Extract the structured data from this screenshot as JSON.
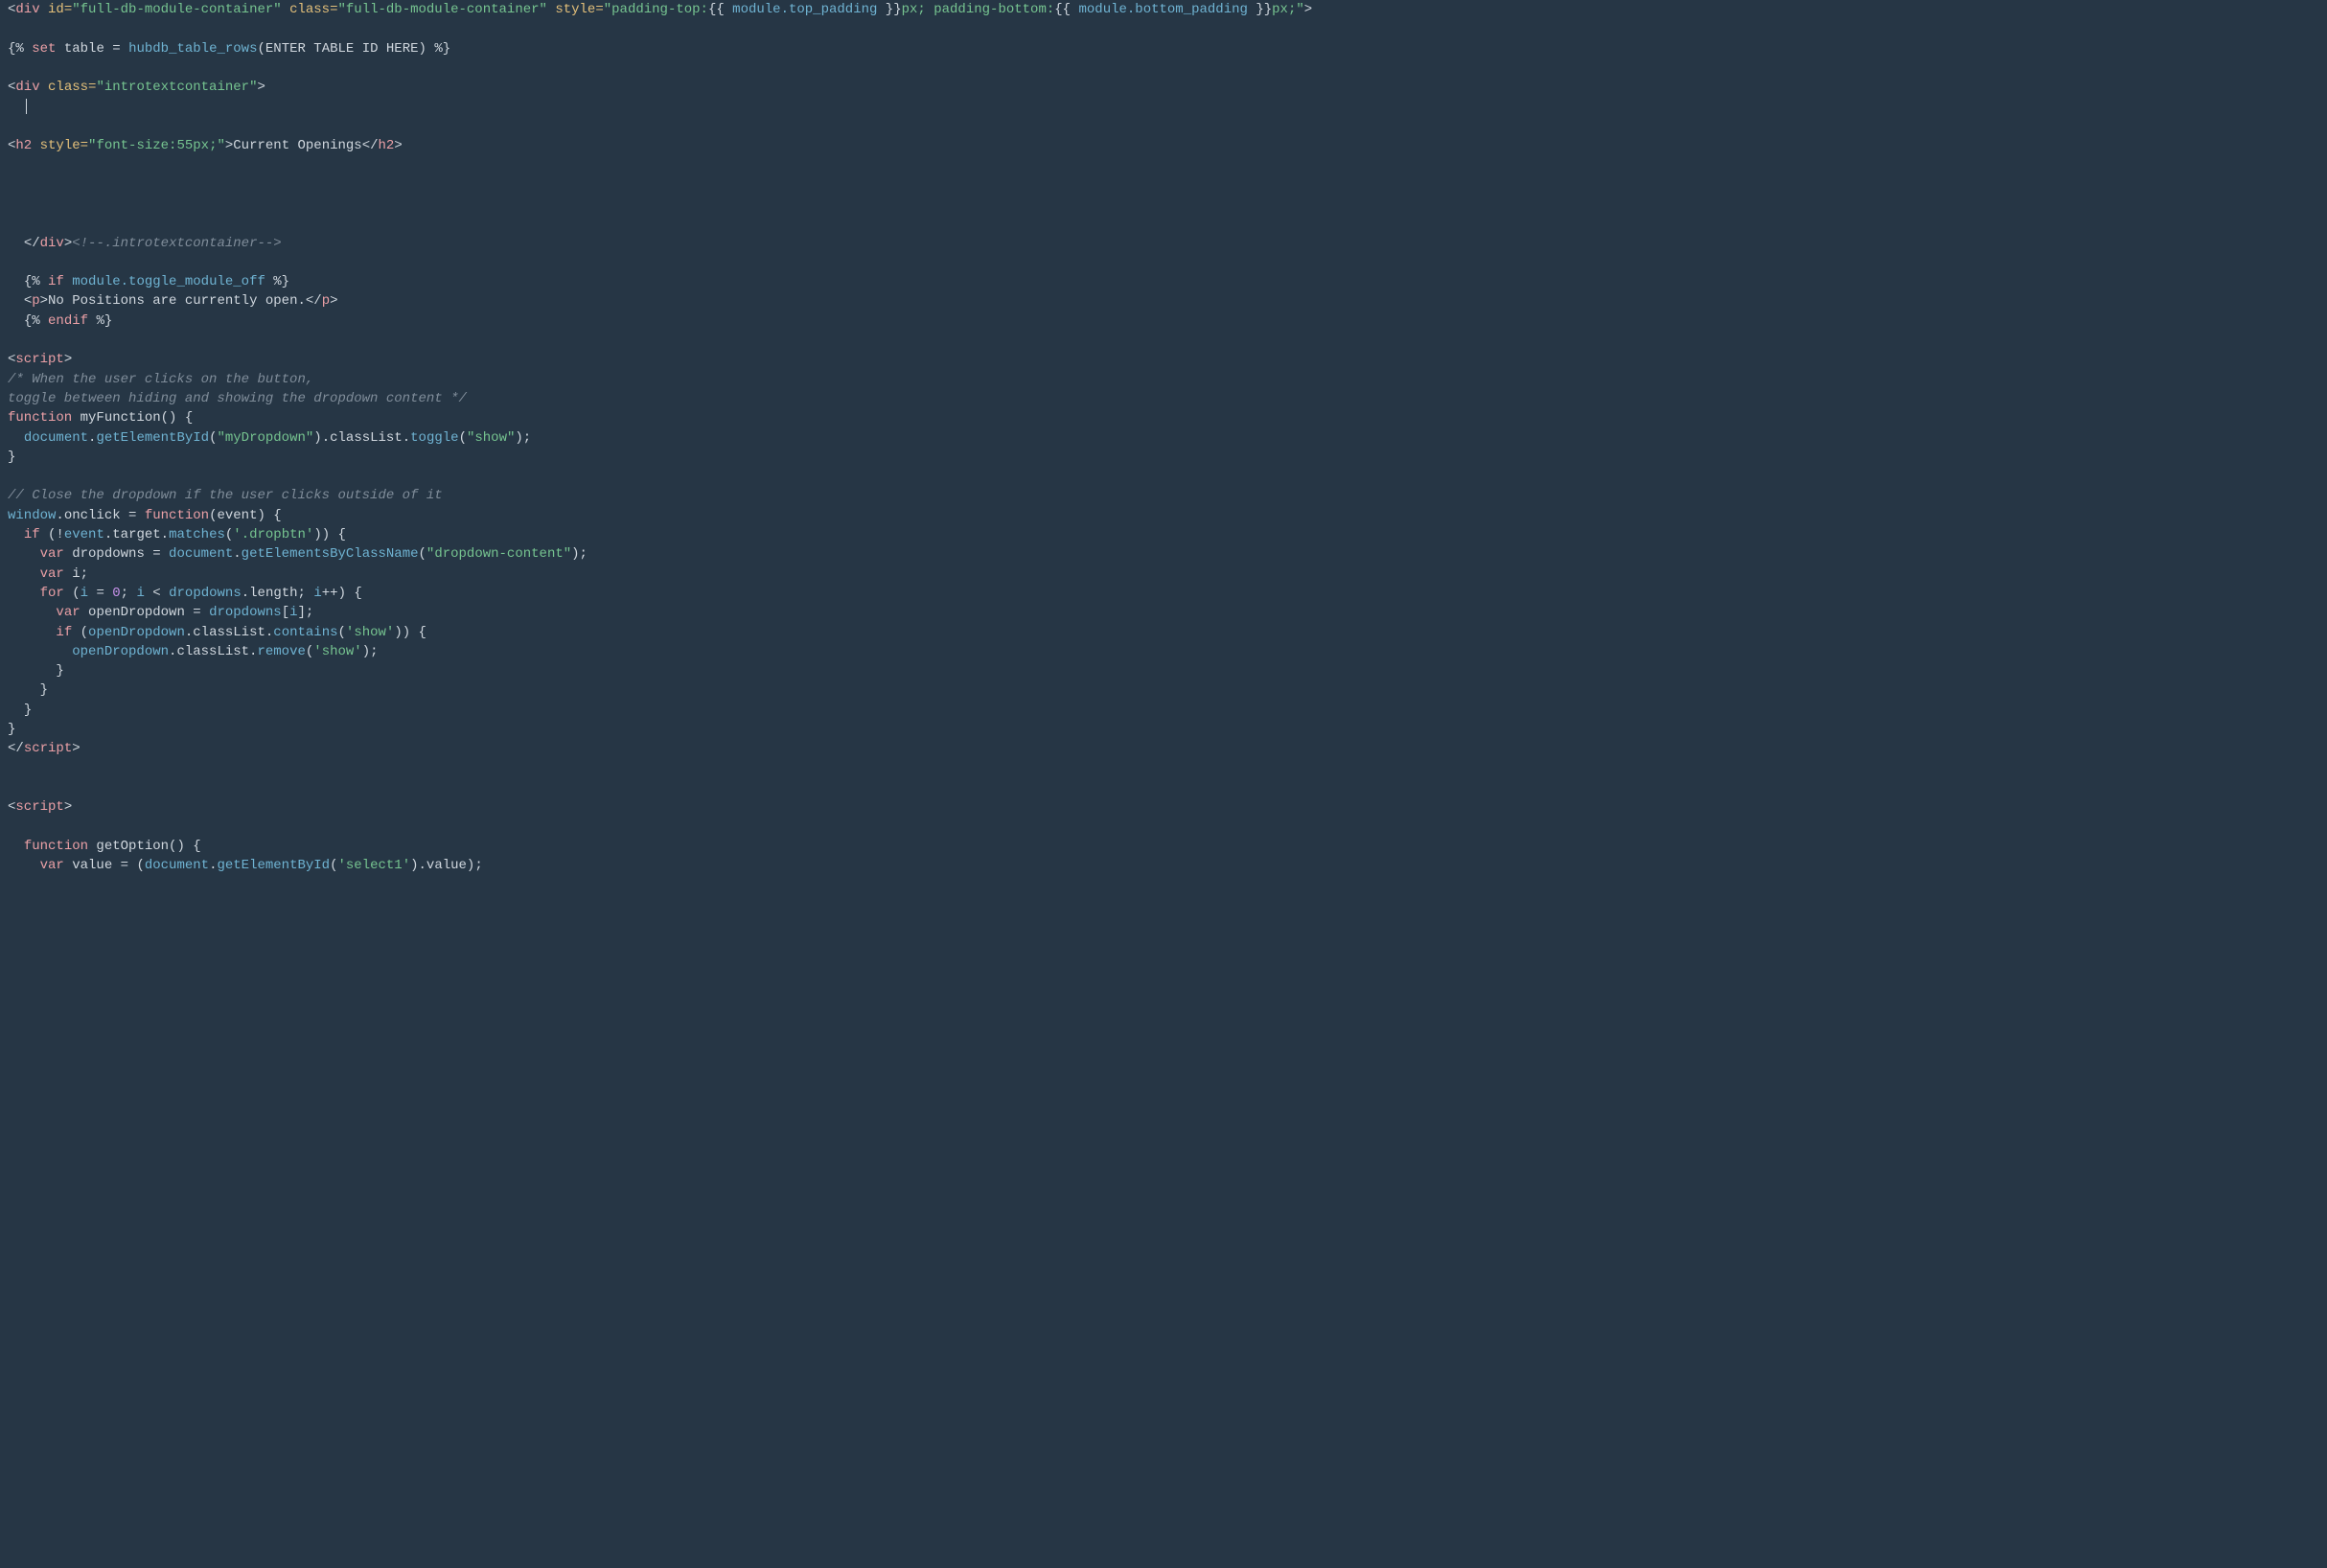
{
  "colors": {
    "bg": "#263645",
    "default": "#d0d7de",
    "tag": "#eba0a6",
    "attr": "#e4c07a",
    "string": "#76c490",
    "comment": "#7f8c99",
    "var": "#6fb3d2",
    "number": "#c792ea"
  },
  "code": {
    "l1": {
      "open": "<div ",
      "id_attr": "id=",
      "id_val": "\"full-db-module-container\"",
      "class_attr": " class=",
      "class_val": "\"full-db-module-container\"",
      "style_attr": " style=",
      "style_open": "\"padding-top:",
      "br_open1": "{{ ",
      "var1": "module.top_padding",
      "br_close1": " }}",
      "mid": "px; padding-bottom:",
      "br_open2": "{{ ",
      "var2": "module.bottom_padding",
      "br_close2": " }}",
      "style_close": "px;\"",
      "end": ">"
    },
    "l3": {
      "open": "{% ",
      "set": "set",
      "mid": " table = ",
      "fn": "hubdb_table_rows",
      "args": "(ENTER TABLE ID HERE)",
      "close": " %}"
    },
    "l5": {
      "open": "<div ",
      "class_attr": "class=",
      "class_val": "\"introtextcontainer\"",
      "end": ">"
    },
    "l7": {
      "open": "<h2 ",
      "style_attr": "style=",
      "style_val": "\"font-size:55px;\"",
      "gt": ">",
      "text": "Current Openings",
      "close": "</h2>"
    },
    "l9": {
      "indent": "  ",
      "close": "</div>",
      "comment": "<!--.introtextcontainer-->"
    },
    "l11": {
      "indent": "  ",
      "open": "{% ",
      "if": "if",
      "cond": " module.toggle_module_off ",
      "close": "%}"
    },
    "l12": {
      "indent": "  ",
      "open": "<p>",
      "text": "No Positions are currently open.",
      "close": "</p>"
    },
    "l13": {
      "indent": "  ",
      "open": "{% ",
      "endif": "endif",
      "close": " %}"
    },
    "l15": {
      "open": "<script>"
    },
    "l16": {
      "text": "/* When the user clicks on the button,"
    },
    "l17": {
      "text": "toggle between hiding and showing the dropdown content */"
    },
    "l18": {
      "kw": "function",
      "name": " myFunction() {"
    },
    "l19": {
      "indent": "  ",
      "a": "document",
      "b": ".",
      "c": "getElementById",
      "d": "(",
      "e": "\"myDropdown\"",
      "f": ").",
      "g": "classList",
      "h": ".",
      "i": "toggle",
      "j": "(",
      "k": "\"show\"",
      "l": ");"
    },
    "l20": {
      "text": "}"
    },
    "l22": {
      "text": "// Close the dropdown if the user clicks outside of it"
    },
    "l23": {
      "a": "window",
      "b": ".onclick = ",
      "c": "function",
      "d": "(event) {"
    },
    "l24": {
      "indent": "  ",
      "a": "if",
      "b": " (!",
      "c": "event",
      "d": ".target.",
      "e": "matches",
      "f": "(",
      "g": "'.dropbtn'",
      "h": ")) {"
    },
    "l25": {
      "indent": "    ",
      "a": "var",
      "b": " dropdowns = ",
      "c": "document",
      "d": ".",
      "e": "getElementsByClassName",
      "f": "(",
      "g": "\"dropdown-content\"",
      "h": ");"
    },
    "l26": {
      "indent": "    ",
      "a": "var",
      "b": " i;"
    },
    "l27": {
      "indent": "    ",
      "a": "for",
      "b": " (",
      "c": "i",
      "d": " = ",
      "e": "0",
      "f": "; ",
      "g": "i",
      "h": " < ",
      "i": "dropdowns",
      "j": ".length; ",
      "k": "i",
      "l": "++) {"
    },
    "l28": {
      "indent": "      ",
      "a": "var",
      "b": " openDropdown = ",
      "c": "dropdowns",
      "d": "[",
      "e": "i",
      "f": "];"
    },
    "l29": {
      "indent": "      ",
      "a": "if",
      "b": " (",
      "c": "openDropdown",
      "d": ".classList.",
      "e": "contains",
      "f": "(",
      "g": "'show'",
      "h": ")) {"
    },
    "l30": {
      "indent": "        ",
      "a": "openDropdown",
      "b": ".classList.",
      "c": "remove",
      "d": "(",
      "e": "'show'",
      "f": ");"
    },
    "l31": {
      "indent": "      ",
      "text": "}"
    },
    "l32": {
      "indent": "    ",
      "text": "}"
    },
    "l33": {
      "indent": "  ",
      "text": "}"
    },
    "l34": {
      "text": "}"
    },
    "l35": {
      "close": "</script>"
    },
    "l37": {
      "open": "<script>"
    },
    "l39": {
      "indent": "  ",
      "kw": "function",
      "name": " getOption() {"
    },
    "l40": {
      "indent": "    ",
      "a": "var",
      "b": " value = (",
      "c": "document",
      "d": ".",
      "e": "getElementById",
      "f": "(",
      "g": "'select1'",
      "h": ").value);"
    }
  }
}
